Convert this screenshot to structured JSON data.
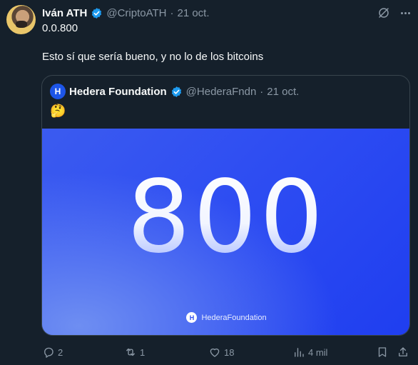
{
  "author": {
    "name": "Iván ATH",
    "handle": "@CriptoATH",
    "separator": "·",
    "date": "21 oct."
  },
  "tweet": {
    "lines": [
      "0.0.800",
      "Esto sí que sería bueno, y no lo de los bitcoins"
    ]
  },
  "quote": {
    "name": "Hedera Foundation",
    "handle": "@HederaFndn",
    "separator": "·",
    "date": "21 oct.",
    "emoji": "🤔",
    "logo_glyph": "H",
    "image": {
      "big_number": "800",
      "brand": "HederaFoundation",
      "brand_glyph": "H"
    }
  },
  "actions": {
    "replies": "2",
    "reposts": "1",
    "likes": "18",
    "views": "4 mil"
  },
  "colors": {
    "background": "#15202b",
    "accent": "#1d9bf0",
    "muted": "#8b98a5",
    "image_blue": "#2e4df2"
  },
  "icons": [
    "verified-badge-icon",
    "grok-icon",
    "more-icon",
    "reply-icon",
    "repost-icon",
    "like-icon",
    "views-icon",
    "bookmark-icon",
    "share-icon"
  ]
}
